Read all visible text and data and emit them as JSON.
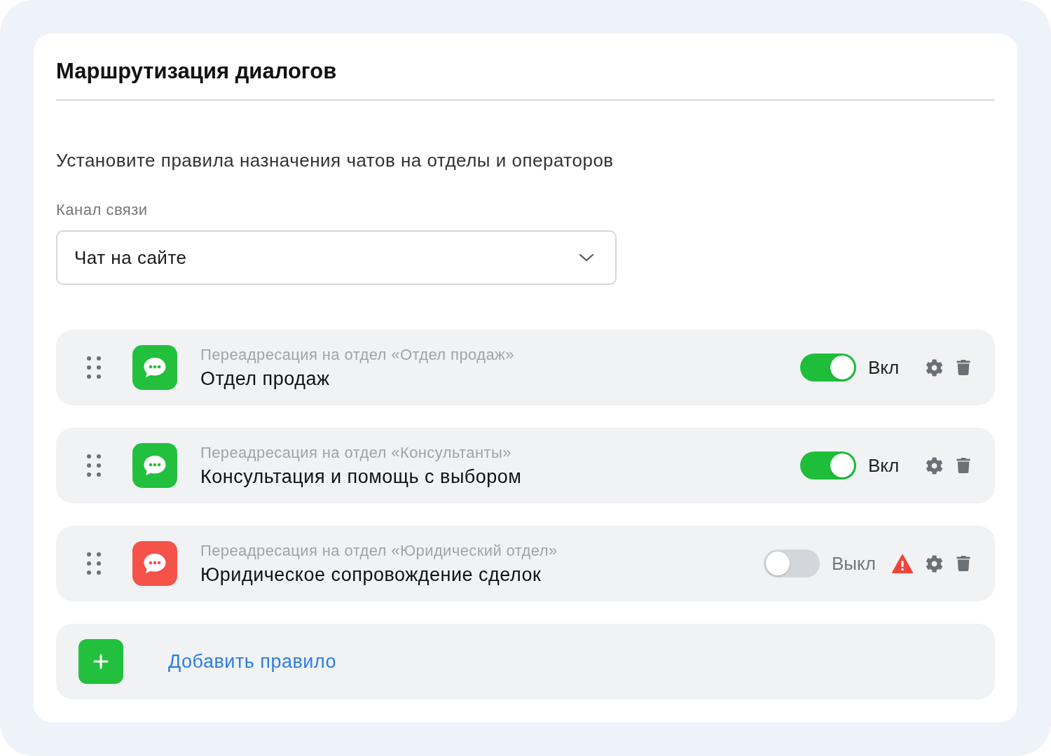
{
  "title": "Маршрутизация диалогов",
  "description": "Установите правила назначения чатов на отделы и операторов",
  "channel": {
    "label": "Канал связи",
    "value": "Чат на сайте"
  },
  "rules": [
    {
      "subtitle": "Переадресация на отдел «Отдел продаж»",
      "name": "Отдел продаж",
      "color": "#22c03c",
      "on": true,
      "status": "Вкл",
      "warning": false
    },
    {
      "subtitle": "Переадресация на отдел «Консультанты»",
      "name": "Консультация и помощь с выбором",
      "color": "#22c03c",
      "on": true,
      "status": "Вкл",
      "warning": false
    },
    {
      "subtitle": "Переадресация на отдел «Юридический отдел»",
      "name": "Юридическое сопровождение сделок",
      "color": "#f5524a",
      "on": false,
      "status": "Выкл",
      "warning": true
    }
  ],
  "add_rule": {
    "label": "Добавить правило"
  }
}
